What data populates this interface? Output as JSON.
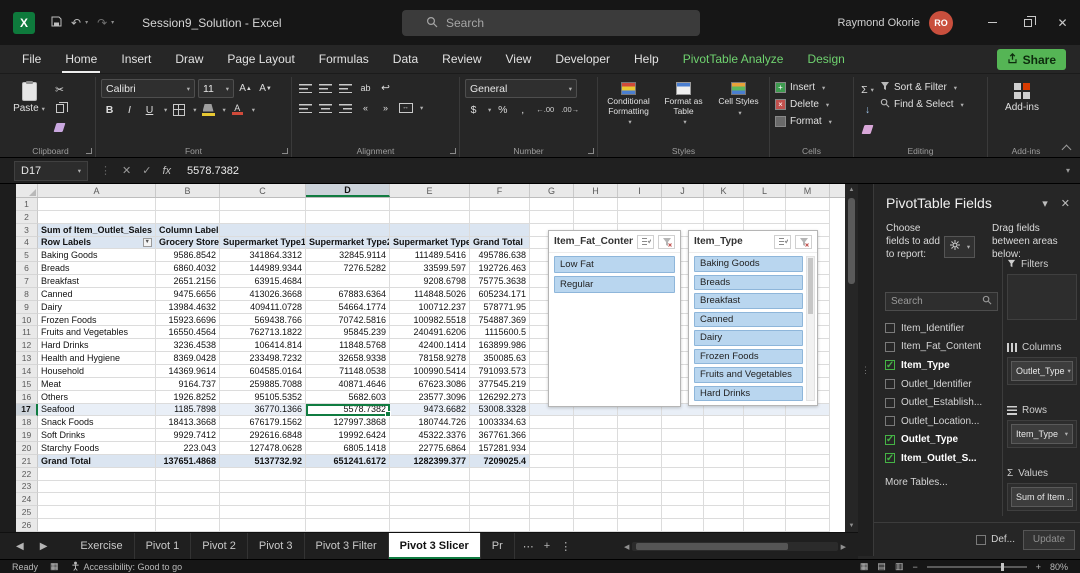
{
  "icons": {
    "chev": "▾",
    "dropdown": "▼",
    "cut": "✂",
    "undo": "↶",
    "redo": "↷",
    "close": "✕",
    "check": "✓",
    "ellipsis": "⋯",
    "plus": "+",
    "kebab": "⋮",
    "prev": "‹",
    "next": "›",
    "left": "◀",
    "right": "▶",
    "up": "▲",
    "down": "▼",
    "cancel": "✕",
    "enter": "✓",
    "dots": "⋮",
    "wrap": "↩",
    "merge": "↔",
    "indent-l": "«",
    "indent-r": "»",
    "fill": "↓",
    "view-normal": "▦",
    "view-layout": "▤",
    "view-break": "▥",
    "minus": "−",
    "grid": "▦"
  },
  "colors": {
    "accent_green": "#107c41",
    "contextual_tab": "#6fd26f",
    "share_green": "#55b555",
    "slicer_selected": "#b9d6ef",
    "pivot_header_fill": "#dbe5f1",
    "check_green": "#45b345",
    "avatar_red": "#c94f3d"
  },
  "titlebar": {
    "doc_title": "Session9_Solution  -  Excel",
    "search_placeholder": "Search",
    "user_name": "Raymond Okorie",
    "user_initials": "RO"
  },
  "ribbon_tabs": {
    "items": [
      {
        "label": "File",
        "active": false,
        "contextual": false
      },
      {
        "label": "Home",
        "active": true,
        "contextual": false
      },
      {
        "label": "Insert",
        "active": false,
        "contextual": false
      },
      {
        "label": "Draw",
        "active": false,
        "contextual": false
      },
      {
        "label": "Page Layout",
        "active": false,
        "contextual": false
      },
      {
        "label": "Formulas",
        "active": false,
        "contextual": false
      },
      {
        "label": "Data",
        "active": false,
        "contextual": false
      },
      {
        "label": "Review",
        "active": false,
        "contextual": false
      },
      {
        "label": "View",
        "active": false,
        "contextual": false
      },
      {
        "label": "Developer",
        "active": false,
        "contextual": false
      },
      {
        "label": "Help",
        "active": false,
        "contextual": false
      },
      {
        "label": "PivotTable Analyze",
        "active": false,
        "contextual": true
      },
      {
        "label": "Design",
        "active": false,
        "contextual": true
      }
    ],
    "share_label": "Share"
  },
  "ribbon": {
    "clipboard": {
      "paste_label": "Paste",
      "group_label": "Clipboard"
    },
    "font": {
      "font_name": "Calibri",
      "font_size": "11",
      "bold": "B",
      "italic": "I",
      "underline": "U",
      "group_label": "Font"
    },
    "alignment": {
      "group_label": "Alignment"
    },
    "number": {
      "format": "General",
      "currency": "$",
      "percent": "%",
      "comma": ",",
      "inc_dec": "←.00",
      "dec_dec": ".00→",
      "group_label": "Number"
    },
    "styles": {
      "buttons": [
        "Conditional Formatting",
        "Format as Table",
        "Cell Styles"
      ],
      "group_label": "Styles"
    },
    "cells": {
      "buttons": [
        "Insert",
        "Delete",
        "Format"
      ],
      "group_label": "Cells"
    },
    "editing": {
      "autosum": "Σ",
      "buttons": [
        "Sort & Filter",
        "Find & Select"
      ],
      "group_label": "Editing"
    },
    "addins": {
      "button_label": "Add-ins",
      "group_label": "Add-ins"
    }
  },
  "formula_bar": {
    "name_box": "D17",
    "fx": "fx",
    "value": "5578.7382"
  },
  "grid": {
    "columns": [
      "A",
      "B",
      "C",
      "D",
      "E",
      "F",
      "G",
      "H",
      "I",
      "J",
      "K",
      "L",
      "M"
    ],
    "row_count": 26,
    "selected_column": "D",
    "selected_row": 17
  },
  "pivot": {
    "title": "Sum of Item_Outlet_Sales",
    "column_labels": "Column Labels",
    "row_labels": "Row Labels",
    "headers": [
      "Grocery Store",
      "Supermarket Type1",
      "Supermarket Type2",
      "Supermarket Type3",
      "Grand Total"
    ],
    "rows": [
      {
        "label": "Baking Goods",
        "values": [
          "9586.8542",
          "341864.3312",
          "32845.9114",
          "111489.5416",
          "495786.638"
        ]
      },
      {
        "label": "Breads",
        "values": [
          "6860.4032",
          "144989.9344",
          "7276.5282",
          "33599.597",
          "192726.463"
        ]
      },
      {
        "label": "Breakfast",
        "values": [
          "2651.2156",
          "63915.4684",
          "",
          "9208.6798",
          "75775.3638"
        ]
      },
      {
        "label": "Canned",
        "values": [
          "9475.6656",
          "413026.3668",
          "67883.6364",
          "114848.5026",
          "605234.171"
        ]
      },
      {
        "label": "Dairy",
        "values": [
          "13984.4632",
          "409411.0728",
          "54664.1774",
          "100712.237",
          "578771.95"
        ]
      },
      {
        "label": "Frozen Foods",
        "values": [
          "15923.6696",
          "569438.766",
          "70742.5816",
          "100982.5518",
          "754887.369"
        ]
      },
      {
        "label": "Fruits and Vegetables",
        "values": [
          "16550.4564",
          "762713.1822",
          "95845.239",
          "240491.6206",
          "1115600.5"
        ]
      },
      {
        "label": "Hard Drinks",
        "values": [
          "3236.4538",
          "106414.814",
          "11848.5768",
          "42400.1414",
          "163899.986"
        ]
      },
      {
        "label": "Health and Hygiene",
        "values": [
          "8369.0428",
          "233498.7232",
          "32658.9338",
          "78158.9278",
          "350085.63"
        ]
      },
      {
        "label": "Household",
        "values": [
          "14369.9614",
          "604585.0164",
          "71148.0538",
          "100990.5414",
          "791093.573"
        ]
      },
      {
        "label": "Meat",
        "values": [
          "9164.737",
          "259885.7088",
          "40871.4646",
          "67623.3086",
          "377545.219"
        ]
      },
      {
        "label": "Others",
        "values": [
          "1926.8252",
          "95105.5352",
          "5682.603",
          "23577.3096",
          "126292.273"
        ]
      },
      {
        "label": "Seafood",
        "values": [
          "1185.7898",
          "36770.1366",
          "5578.7382",
          "9473.6682",
          "53008.3328"
        ]
      },
      {
        "label": "Snack Foods",
        "values": [
          "18413.3668",
          "676179.1562",
          "127997.3868",
          "180744.726",
          "1003334.63"
        ]
      },
      {
        "label": "Soft Drinks",
        "values": [
          "9929.7412",
          "292616.6848",
          "19992.6424",
          "45322.3376",
          "367761.366"
        ]
      },
      {
        "label": "Starchy Foods",
        "values": [
          "223.043",
          "127478.0628",
          "6805.1418",
          "22775.6864",
          "157281.934"
        ]
      }
    ],
    "grand_total": {
      "label": "Grand Total",
      "values": [
        "137651.4868",
        "5137732.92",
        "651241.6172",
        "1282399.377",
        "7209025.4"
      ]
    }
  },
  "slicers": [
    {
      "title": "Item_Fat_Content",
      "items": [
        {
          "label": "Low Fat",
          "selected": true
        },
        {
          "label": "Regular",
          "selected": true
        }
      ],
      "scrollbar": false
    },
    {
      "title": "Item_Type",
      "items": [
        {
          "label": "Baking Goods",
          "selected": true
        },
        {
          "label": "Breads",
          "selected": true
        },
        {
          "label": "Breakfast",
          "selected": true
        },
        {
          "label": "Canned",
          "selected": true
        },
        {
          "label": "Dairy",
          "selected": true
        },
        {
          "label": "Frozen Foods",
          "selected": true
        },
        {
          "label": "Fruits and Vegetables",
          "selected": true
        },
        {
          "label": "Hard Drinks",
          "selected": true
        }
      ],
      "scrollbar": true
    }
  ],
  "fields_pane": {
    "title": "PivotTable Fields",
    "choose_text": "Choose fields to add to report:",
    "drag_text": "Drag fields between areas below:",
    "search_placeholder": "Search",
    "fields": [
      {
        "name": "Item_Identifier",
        "checked": false
      },
      {
        "name": "Item_Fat_Content",
        "checked": false
      },
      {
        "name": "Item_Type",
        "checked": true
      },
      {
        "name": "Outlet_Identifier",
        "checked": false
      },
      {
        "name": "Outlet_Establish...",
        "checked": false
      },
      {
        "name": "Outlet_Location...",
        "checked": false
      },
      {
        "name": "Outlet_Type",
        "checked": true
      },
      {
        "name": "Item_Outlet_S...",
        "checked": true
      }
    ],
    "more_tables": "More Tables...",
    "areas": {
      "filters_label": "Filters",
      "columns_label": "Columns",
      "columns_value": "Outlet_Type",
      "rows_label": "Rows",
      "rows_value": "Item_Type",
      "values_label": "Values",
      "values_sigma": "Σ",
      "values_value": "Sum of Item ..."
    },
    "defer_label": "Def...",
    "update_label": "Update"
  },
  "sheet_bar": {
    "tabs": [
      {
        "label": "Exercise",
        "active": false
      },
      {
        "label": "Pivot 1",
        "active": false
      },
      {
        "label": "Pivot 2",
        "active": false
      },
      {
        "label": "Pivot 3",
        "active": false
      },
      {
        "label": "Pivot 3 Filter",
        "active": false
      },
      {
        "label": "Pivot 3 Slicer",
        "active": true
      },
      {
        "label": "Pr",
        "active": false
      }
    ]
  },
  "status_bar": {
    "ready": "Ready",
    "accessibility": "Accessibility: Good to go",
    "zoom": "80%"
  }
}
